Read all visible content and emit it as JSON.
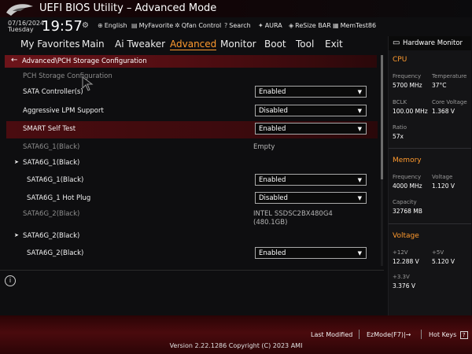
{
  "window": {
    "title": "UEFI BIOS Utility – Advanced Mode"
  },
  "toolbar": {
    "date": "07/16/2024",
    "day": "Tuesday",
    "time": "19:57",
    "items": [
      {
        "label": "English",
        "icon": "globe-icon"
      },
      {
        "label": "MyFavorite",
        "icon": "star-list-icon"
      },
      {
        "label": "Qfan Control",
        "icon": "fan-icon"
      },
      {
        "label": "Search",
        "icon": "help-search-icon"
      },
      {
        "label": "AURA",
        "icon": "aura-icon"
      },
      {
        "label": "ReSize BAR",
        "icon": "resize-bar-icon"
      },
      {
        "label": "MemTest86",
        "icon": "memtest-icon"
      }
    ]
  },
  "nav": {
    "items": [
      "My Favorites",
      "Main",
      "Ai Tweaker",
      "Advanced",
      "Monitor",
      "Boot",
      "Tool",
      "Exit"
    ],
    "active": "Advanced"
  },
  "main": {
    "breadcrumb": "Advanced\\PCH Storage Configuration",
    "rows": [
      {
        "label": "PCH Storage Configuration"
      },
      {
        "label": "SATA Controller(s)",
        "value": "Enabled"
      },
      {
        "label": "Aggressive LPM Support",
        "value": "Disabled"
      },
      {
        "label": "SMART Self Test",
        "value": "Enabled"
      },
      {
        "label": "SATA6G_1(Black)",
        "value": "Empty"
      },
      {
        "label": "SATA6G_1(Black)"
      },
      {
        "label": "SATA6G_1(Black)",
        "value": "Enabled"
      },
      {
        "label": "SATA6G_1 Hot Plug",
        "value": "Disabled"
      },
      {
        "label": "SATA6G_2(Black)",
        "value_line1": "INTEL SSDSC2BX480G4",
        "value_line2": "(480.1GB)"
      },
      {
        "label": "SATA6G_2(Black)"
      },
      {
        "label": "SATA6G_2(Black)",
        "value": "Enabled"
      }
    ]
  },
  "hw": {
    "title": "Hardware Monitor",
    "cpu": {
      "section": "CPU",
      "frequency_label": "Frequency",
      "frequency": "5700 MHz",
      "temperature_label": "Temperature",
      "temperature": "37°C",
      "bclk_label": "BCLK",
      "bclk": "100.00 MHz",
      "core_voltage_label": "Core Voltage",
      "core_voltage": "1.368 V",
      "ratio_label": "Ratio",
      "ratio": "57x"
    },
    "memory": {
      "section": "Memory",
      "frequency_label": "Frequency",
      "frequency": "4000 MHz",
      "voltage_label": "Voltage",
      "voltage": "1.120 V",
      "capacity_label": "Capacity",
      "capacity": "32768 MB"
    },
    "voltage": {
      "section": "Voltage",
      "v12_label": "+12V",
      "v12": "12.288 V",
      "v5_label": "+5V",
      "v5": "5.120 V",
      "v33_label": "+3.3V",
      "v33": "3.376 V"
    }
  },
  "footer": {
    "last_modified": "Last Modified",
    "ezmode": "EzMode(F7)|→",
    "hotkeys": "Hot Keys",
    "hotkeys_key": "?",
    "copyright": "Version 2.22.1286 Copyright (C) 2023 AMI"
  },
  "colors": {
    "accent": "#ff9a2e",
    "highlight_red": "#6d141a"
  }
}
